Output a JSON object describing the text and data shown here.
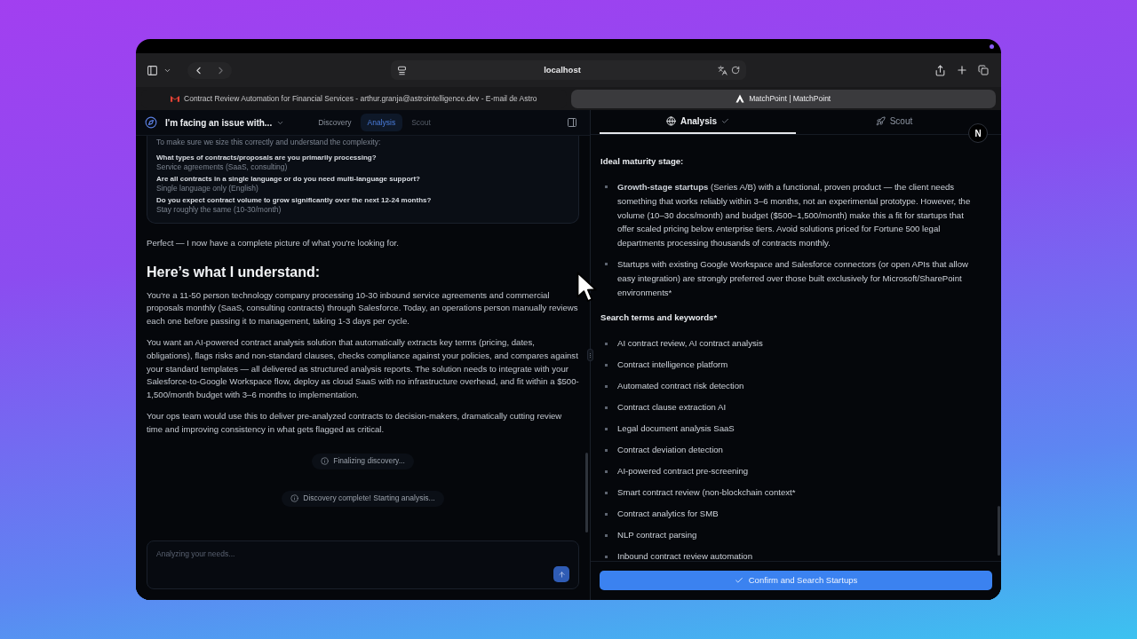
{
  "browser": {
    "url": "localhost",
    "tabs": [
      {
        "title": "Contract Review Automation for Financial Services - arthur.granja@astrointelligence.dev - E-mail de Astro",
        "selected": false
      },
      {
        "title": "MatchPoint | MatchPoint",
        "selected": true
      }
    ]
  },
  "left_panel": {
    "conversation_title": "I'm facing an issue with...",
    "mode_tabs": [
      {
        "label": "Discovery",
        "selected": false,
        "disabled": false
      },
      {
        "label": "Analysis",
        "selected": true,
        "disabled": false
      },
      {
        "label": "Scout",
        "selected": false,
        "disabled": true
      }
    ],
    "questions_card": {
      "intro": "To make sure we size this correctly and understand the complexity:",
      "items": [
        {
          "question": "What types of contracts/proposals are you primarily processing?",
          "answer": "Service agreements (SaaS, consulting)"
        },
        {
          "question": "Are all contracts in a single language or do you need multi-language support?",
          "answer": "Single language only (English)"
        },
        {
          "question": "Do you expect contract volume to grow significantly over the next 12-24 months?",
          "answer": "Stay roughly the same (10-30/month)"
        }
      ]
    },
    "messages": [
      {
        "kind": "paragraph",
        "text": "Perfect — I now have a complete picture of what you're looking for."
      },
      {
        "kind": "heading",
        "text": "Here’s what I understand:"
      },
      {
        "kind": "paragraph",
        "text": "You're a 11-50 person technology company processing 10-30 inbound service agreements and commercial proposals monthly (SaaS, consulting contracts) through Salesforce. Today, an operations person manually reviews each one before passing it to management, taking 1-3 days per cycle."
      },
      {
        "kind": "paragraph",
        "text": "You want an AI-powered contract analysis solution that automatically extracts key terms (pricing, dates, obligations), flags risks and non-standard clauses, checks compliance against your policies, and compares against your standard templates — all delivered as structured analysis reports. The solution needs to integrate with your Salesforce-to-Google Workspace flow, deploy as cloud SaaS with no infrastructure overhead, and fit within a $500-1,500/month budget with 3–6 months to implementation."
      },
      {
        "kind": "paragraph",
        "text": "Your ops team would use this to deliver pre-analyzed contracts to decision-makers, dramatically cutting review time and improving consistency in what gets flagged as critical."
      }
    ],
    "status_notes": [
      "Finalizing discovery...",
      "Discovery complete! Starting analysis..."
    ],
    "composer": {
      "placeholder": "Analyzing your needs..."
    }
  },
  "right_panel": {
    "tabs": [
      {
        "label": "Analysis",
        "selected": true,
        "done": true
      },
      {
        "label": "Scout",
        "selected": false,
        "done": false
      }
    ],
    "avatar": "N",
    "sections": [
      {
        "heading": "Ideal maturity stage:",
        "items": [
          "**Growth-stage startups** (Series A/B) with a functional, proven product — the client needs something that works reliably within 3–6 months, not an experimental prototype. However, the volume (10–30 docs/month) and budget ($500–1,500/month) make this a fit for startups that offer scaled pricing below enterprise tiers. Avoid solutions priced for Fortune 500 legal departments processing thousands of contracts monthly.",
          "Startups with existing Google Workspace and Salesforce connectors (or open APIs that allow easy integration) are strongly preferred over those built exclusively for Microsoft/SharePoint environments*"
        ]
      },
      {
        "heading": "Search terms and keywords*",
        "items": [
          "AI contract review, AI contract analysis",
          "Contract intelligence platform",
          "Automated contract risk detection",
          "Contract clause extraction AI",
          "Legal document analysis SaaS",
          "Contract deviation detection",
          "AI-powered contract pre-screening",
          "Smart contract review (non-blockchain context*",
          "Contract analytics for SMB",
          "NLP contract parsing",
          "Inbound contract review automation"
        ]
      }
    ],
    "confirm_button": "Confirm and Search Startups"
  }
}
